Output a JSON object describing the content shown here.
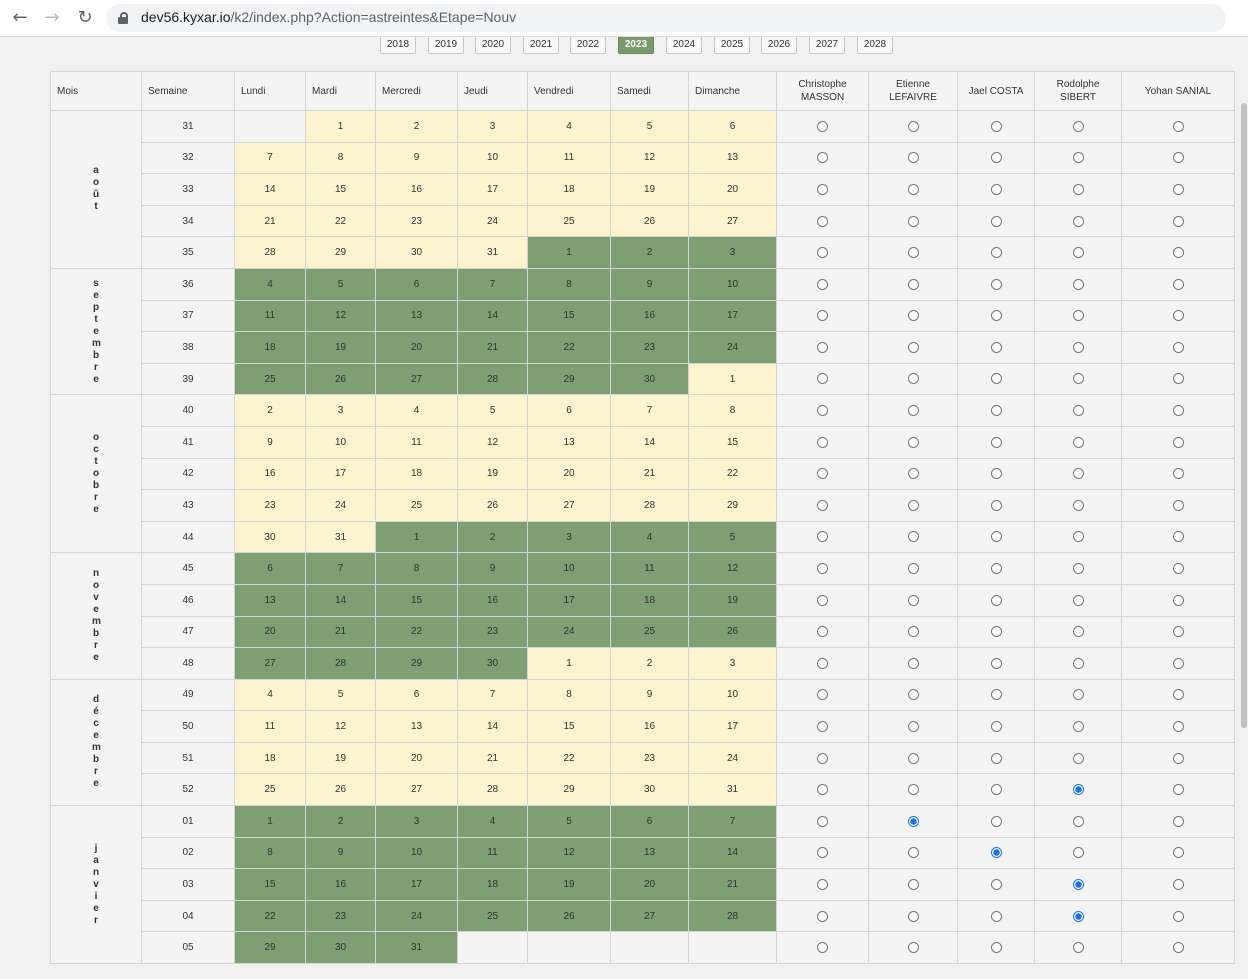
{
  "browser": {
    "url_host": "dev56.kyxar.io",
    "url_path": "/k2/index.php?Action=astreintes&Etape=Nouv"
  },
  "years": {
    "items": [
      "2018",
      "2019",
      "2020",
      "2021",
      "2022",
      "2023",
      "2024",
      "2025",
      "2026",
      "2027",
      "2028"
    ],
    "active": "2023"
  },
  "table": {
    "headers": {
      "mois": "Mois",
      "semaine": "Semaine",
      "days": [
        "Lundi",
        "Mardi",
        "Mercredi",
        "Jeudi",
        "Vendredi",
        "Samedi",
        "Dimanche"
      ],
      "people": [
        [
          "Christophe",
          "MASSON"
        ],
        [
          "Etienne",
          "LEFAIVRE"
        ],
        [
          "Jael COSTA",
          ""
        ],
        [
          "Rodolphe",
          "SIBERT"
        ],
        [
          "Yohan SANIAL",
          ""
        ]
      ]
    },
    "months": [
      {
        "name": "août",
        "rows": 5
      },
      {
        "name": "septembre",
        "rows": 4
      },
      {
        "name": "octobre",
        "rows": 5
      },
      {
        "name": "novembre",
        "rows": 4
      },
      {
        "name": "décembre",
        "rows": 4
      },
      {
        "name": "janvier",
        "rows": 5
      }
    ],
    "weeks": [
      {
        "week": "31",
        "days": [
          [
            "",
            "e"
          ],
          [
            "1",
            "y"
          ],
          [
            "2",
            "y"
          ],
          [
            "3",
            "y"
          ],
          [
            "4",
            "y"
          ],
          [
            "5",
            "y"
          ],
          [
            "6",
            "y"
          ]
        ],
        "selected": -1
      },
      {
        "week": "32",
        "days": [
          [
            "7",
            "y"
          ],
          [
            "8",
            "y"
          ],
          [
            "9",
            "y"
          ],
          [
            "10",
            "y"
          ],
          [
            "11",
            "y"
          ],
          [
            "12",
            "y"
          ],
          [
            "13",
            "y"
          ]
        ],
        "selected": -1
      },
      {
        "week": "33",
        "days": [
          [
            "14",
            "y"
          ],
          [
            "15",
            "y"
          ],
          [
            "16",
            "y"
          ],
          [
            "17",
            "y"
          ],
          [
            "18",
            "y"
          ],
          [
            "19",
            "y"
          ],
          [
            "20",
            "y"
          ]
        ],
        "selected": -1
      },
      {
        "week": "34",
        "days": [
          [
            "21",
            "y"
          ],
          [
            "22",
            "y"
          ],
          [
            "23",
            "y"
          ],
          [
            "24",
            "y"
          ],
          [
            "25",
            "y"
          ],
          [
            "26",
            "y"
          ],
          [
            "27",
            "y"
          ]
        ],
        "selected": -1
      },
      {
        "week": "35",
        "days": [
          [
            "28",
            "y"
          ],
          [
            "29",
            "y"
          ],
          [
            "30",
            "y"
          ],
          [
            "31",
            "y"
          ],
          [
            "1",
            "g"
          ],
          [
            "2",
            "g"
          ],
          [
            "3",
            "g"
          ]
        ],
        "selected": -1
      },
      {
        "week": "36",
        "days": [
          [
            "4",
            "g"
          ],
          [
            "5",
            "g"
          ],
          [
            "6",
            "g"
          ],
          [
            "7",
            "g"
          ],
          [
            "8",
            "g"
          ],
          [
            "9",
            "g"
          ],
          [
            "10",
            "g"
          ]
        ],
        "selected": -1
      },
      {
        "week": "37",
        "days": [
          [
            "11",
            "g"
          ],
          [
            "12",
            "g"
          ],
          [
            "13",
            "g"
          ],
          [
            "14",
            "g"
          ],
          [
            "15",
            "g"
          ],
          [
            "16",
            "g"
          ],
          [
            "17",
            "g"
          ]
        ],
        "selected": -1
      },
      {
        "week": "38",
        "days": [
          [
            "18",
            "g"
          ],
          [
            "19",
            "g"
          ],
          [
            "20",
            "g"
          ],
          [
            "21",
            "g"
          ],
          [
            "22",
            "g"
          ],
          [
            "23",
            "g"
          ],
          [
            "24",
            "g"
          ]
        ],
        "selected": -1
      },
      {
        "week": "39",
        "days": [
          [
            "25",
            "g"
          ],
          [
            "26",
            "g"
          ],
          [
            "27",
            "g"
          ],
          [
            "28",
            "g"
          ],
          [
            "29",
            "g"
          ],
          [
            "30",
            "g"
          ],
          [
            "1",
            "y"
          ]
        ],
        "selected": -1
      },
      {
        "week": "40",
        "days": [
          [
            "2",
            "y"
          ],
          [
            "3",
            "y"
          ],
          [
            "4",
            "y"
          ],
          [
            "5",
            "y"
          ],
          [
            "6",
            "y"
          ],
          [
            "7",
            "y"
          ],
          [
            "8",
            "y"
          ]
        ],
        "selected": -1
      },
      {
        "week": "41",
        "days": [
          [
            "9",
            "y"
          ],
          [
            "10",
            "y"
          ],
          [
            "11",
            "y"
          ],
          [
            "12",
            "y"
          ],
          [
            "13",
            "y"
          ],
          [
            "14",
            "y"
          ],
          [
            "15",
            "y"
          ]
        ],
        "selected": -1
      },
      {
        "week": "42",
        "days": [
          [
            "16",
            "y"
          ],
          [
            "17",
            "y"
          ],
          [
            "18",
            "y"
          ],
          [
            "19",
            "y"
          ],
          [
            "20",
            "y"
          ],
          [
            "21",
            "y"
          ],
          [
            "22",
            "y"
          ]
        ],
        "selected": -1
      },
      {
        "week": "43",
        "days": [
          [
            "23",
            "y"
          ],
          [
            "24",
            "y"
          ],
          [
            "25",
            "y"
          ],
          [
            "26",
            "y"
          ],
          [
            "27",
            "y"
          ],
          [
            "28",
            "y"
          ],
          [
            "29",
            "y"
          ]
        ],
        "selected": -1
      },
      {
        "week": "44",
        "days": [
          [
            "30",
            "y"
          ],
          [
            "31",
            "y"
          ],
          [
            "1",
            "g"
          ],
          [
            "2",
            "g"
          ],
          [
            "3",
            "g"
          ],
          [
            "4",
            "g"
          ],
          [
            "5",
            "g"
          ]
        ],
        "selected": -1
      },
      {
        "week": "45",
        "days": [
          [
            "6",
            "g"
          ],
          [
            "7",
            "g"
          ],
          [
            "8",
            "g"
          ],
          [
            "9",
            "g"
          ],
          [
            "10",
            "g"
          ],
          [
            "11",
            "g"
          ],
          [
            "12",
            "g"
          ]
        ],
        "selected": -1
      },
      {
        "week": "46",
        "days": [
          [
            "13",
            "g"
          ],
          [
            "14",
            "g"
          ],
          [
            "15",
            "g"
          ],
          [
            "16",
            "g"
          ],
          [
            "17",
            "g"
          ],
          [
            "18",
            "g"
          ],
          [
            "19",
            "g"
          ]
        ],
        "selected": -1
      },
      {
        "week": "47",
        "days": [
          [
            "20",
            "g"
          ],
          [
            "21",
            "g"
          ],
          [
            "22",
            "g"
          ],
          [
            "23",
            "g"
          ],
          [
            "24",
            "g"
          ],
          [
            "25",
            "g"
          ],
          [
            "26",
            "g"
          ]
        ],
        "selected": -1
      },
      {
        "week": "48",
        "days": [
          [
            "27",
            "g"
          ],
          [
            "28",
            "g"
          ],
          [
            "29",
            "g"
          ],
          [
            "30",
            "g"
          ],
          [
            "1",
            "y"
          ],
          [
            "2",
            "y"
          ],
          [
            "3",
            "y"
          ]
        ],
        "selected": -1
      },
      {
        "week": "49",
        "days": [
          [
            "4",
            "y"
          ],
          [
            "5",
            "y"
          ],
          [
            "6",
            "y"
          ],
          [
            "7",
            "y"
          ],
          [
            "8",
            "y"
          ],
          [
            "9",
            "y"
          ],
          [
            "10",
            "y"
          ]
        ],
        "selected": -1
      },
      {
        "week": "50",
        "days": [
          [
            "11",
            "y"
          ],
          [
            "12",
            "y"
          ],
          [
            "13",
            "y"
          ],
          [
            "14",
            "y"
          ],
          [
            "15",
            "y"
          ],
          [
            "16",
            "y"
          ],
          [
            "17",
            "y"
          ]
        ],
        "selected": -1
      },
      {
        "week": "51",
        "days": [
          [
            "18",
            "y"
          ],
          [
            "19",
            "y"
          ],
          [
            "20",
            "y"
          ],
          [
            "21",
            "y"
          ],
          [
            "22",
            "y"
          ],
          [
            "23",
            "y"
          ],
          [
            "24",
            "y"
          ]
        ],
        "selected": -1
      },
      {
        "week": "52",
        "days": [
          [
            "25",
            "y"
          ],
          [
            "26",
            "y"
          ],
          [
            "27",
            "y"
          ],
          [
            "28",
            "y"
          ],
          [
            "29",
            "y"
          ],
          [
            "30",
            "y"
          ],
          [
            "31",
            "y"
          ]
        ],
        "selected": 3
      },
      {
        "week": "01",
        "days": [
          [
            "1",
            "g"
          ],
          [
            "2",
            "g"
          ],
          [
            "3",
            "g"
          ],
          [
            "4",
            "g"
          ],
          [
            "5",
            "g"
          ],
          [
            "6",
            "g"
          ],
          [
            "7",
            "g"
          ]
        ],
        "selected": 1
      },
      {
        "week": "02",
        "days": [
          [
            "8",
            "g"
          ],
          [
            "9",
            "g"
          ],
          [
            "10",
            "g"
          ],
          [
            "11",
            "g"
          ],
          [
            "12",
            "g"
          ],
          [
            "13",
            "g"
          ],
          [
            "14",
            "g"
          ]
        ],
        "selected": 2
      },
      {
        "week": "03",
        "days": [
          [
            "15",
            "g"
          ],
          [
            "16",
            "g"
          ],
          [
            "17",
            "g"
          ],
          [
            "18",
            "g"
          ],
          [
            "19",
            "g"
          ],
          [
            "20",
            "g"
          ],
          [
            "21",
            "g"
          ]
        ],
        "selected": 3
      },
      {
        "week": "04",
        "days": [
          [
            "22",
            "g"
          ],
          [
            "23",
            "g"
          ],
          [
            "24",
            "g"
          ],
          [
            "25",
            "g"
          ],
          [
            "26",
            "g"
          ],
          [
            "27",
            "g"
          ],
          [
            "28",
            "g"
          ]
        ],
        "selected": 3
      },
      {
        "week": "05",
        "days": [
          [
            "29",
            "g"
          ],
          [
            "30",
            "g"
          ],
          [
            "31",
            "g"
          ],
          [
            "",
            "e"
          ],
          [
            "",
            "e"
          ],
          [
            "",
            "e"
          ],
          [
            "",
            "e"
          ]
        ],
        "selected": -1
      }
    ]
  },
  "colors": {
    "yellow_day": "#fcf3cf",
    "green_day": "#7e9e73",
    "active_year": "#7b9a6c"
  }
}
